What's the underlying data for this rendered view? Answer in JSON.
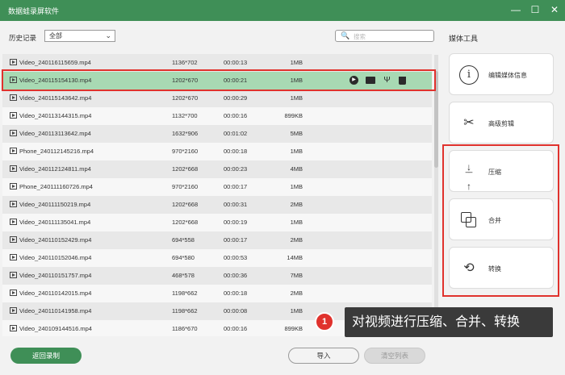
{
  "window": {
    "title": "数据蛙录屏软件",
    "controls": [
      "minimize",
      "maximize",
      "close"
    ]
  },
  "filter": {
    "label": "历史记录",
    "selected": "全部",
    "search_placeholder": "搜索"
  },
  "files": [
    {
      "name": "Video_240116115659.mp4",
      "resolution": "1136*702",
      "duration": "00:00:13",
      "size": "1MB"
    },
    {
      "name": "Video_240115154130.mp4",
      "resolution": "1202*670",
      "duration": "00:00:21",
      "size": "1MB",
      "selected": true
    },
    {
      "name": "Video_240115143642.mp4",
      "resolution": "1202*670",
      "duration": "00:00:29",
      "size": "1MB"
    },
    {
      "name": "Video_240113144315.mp4",
      "resolution": "1132*700",
      "duration": "00:00:16",
      "size": "899KB"
    },
    {
      "name": "Video_240113113642.mp4",
      "resolution": "1632*906",
      "duration": "00:01:02",
      "size": "5MB"
    },
    {
      "name": "Phone_240112145216.mp4",
      "resolution": "970*2160",
      "duration": "00:00:18",
      "size": "1MB"
    },
    {
      "name": "Video_240112124811.mp4",
      "resolution": "1202*668",
      "duration": "00:00:23",
      "size": "4MB"
    },
    {
      "name": "Phone_240111160726.mp4",
      "resolution": "970*2160",
      "duration": "00:00:17",
      "size": "1MB"
    },
    {
      "name": "Video_240111150219.mp4",
      "resolution": "1202*668",
      "duration": "00:00:31",
      "size": "2MB"
    },
    {
      "name": "Video_240111135041.mp4",
      "resolution": "1202*668",
      "duration": "00:00:19",
      "size": "1MB"
    },
    {
      "name": "Video_240110152429.mp4",
      "resolution": "694*558",
      "duration": "00:00:17",
      "size": "2MB"
    },
    {
      "name": "Video_240110152046.mp4",
      "resolution": "694*580",
      "duration": "00:00:53",
      "size": "14MB"
    },
    {
      "name": "Video_240110151757.mp4",
      "resolution": "468*578",
      "duration": "00:00:36",
      "size": "7MB"
    },
    {
      "name": "Video_240110142015.mp4",
      "resolution": "1198*662",
      "duration": "00:00:18",
      "size": "2MB"
    },
    {
      "name": "Video_240110141958.mp4",
      "resolution": "1198*662",
      "duration": "00:00:08",
      "size": "1MB"
    },
    {
      "name": "Video_240109144516.mp4",
      "resolution": "1186*670",
      "duration": "00:00:16",
      "size": "899KB"
    }
  ],
  "row_actions": [
    "play-icon",
    "folder-icon",
    "edit-tool-icon",
    "delete-icon"
  ],
  "media_tools": {
    "title": "媒体工具",
    "items": [
      {
        "label": "编辑媒体信息",
        "icon": "info-icon"
      },
      {
        "label": "高级剪辑",
        "icon": "scissors-icon"
      },
      {
        "label": "压缩",
        "icon": "compress-icon"
      },
      {
        "label": "合并",
        "icon": "merge-icon"
      },
      {
        "label": "转换",
        "icon": "convert-icon"
      }
    ]
  },
  "footer": {
    "back_label": "返回录制",
    "import_label": "导入",
    "clear_label": "清空列表"
  },
  "annotation": {
    "badge": "1",
    "text": "对视频进行压缩、合并、转换"
  },
  "colors": {
    "brand": "#3f8f57",
    "selected_row": "#a8d9b3",
    "highlight": "#e0322d"
  }
}
